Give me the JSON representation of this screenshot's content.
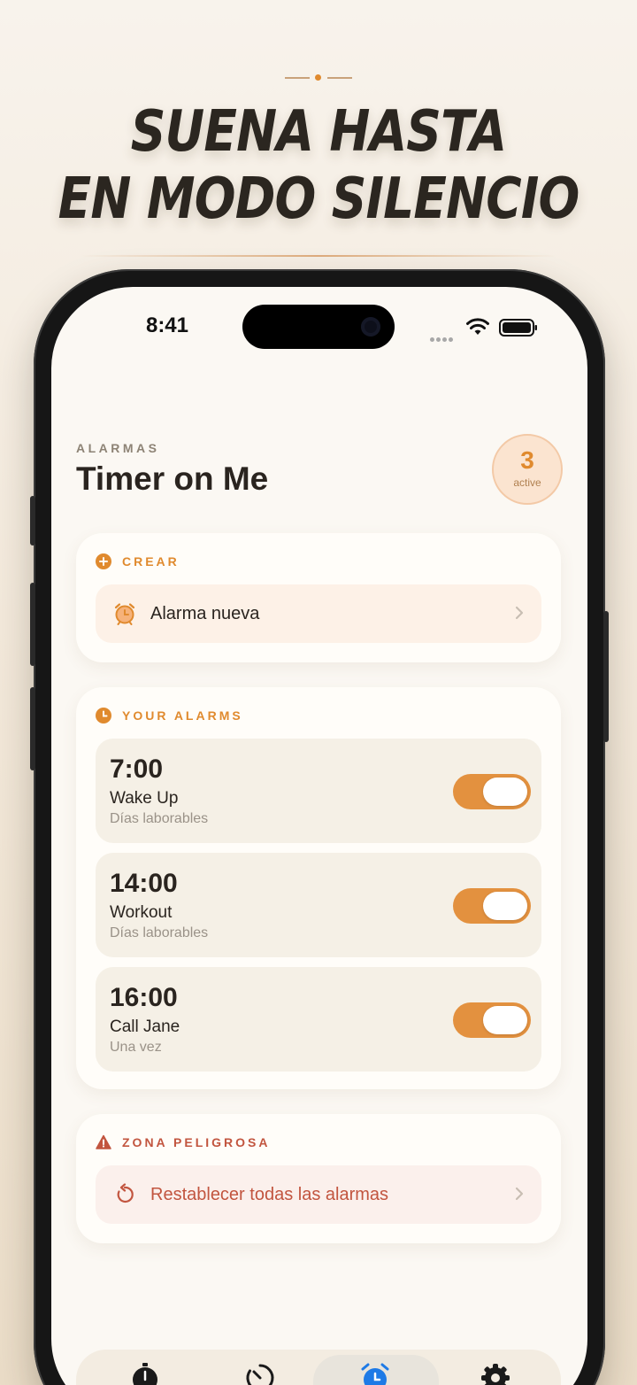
{
  "marketing": {
    "headline_line1": "SUENA HASTA",
    "headline_line2": "EN MODO SILENCIO"
  },
  "status_bar": {
    "time": "8:41"
  },
  "header": {
    "eyebrow": "ALARMAS",
    "title": "Timer on Me",
    "active_count": "3",
    "active_label": "active"
  },
  "create_section": {
    "label": "CREAR",
    "new_alarm_label": "Alarma nueva"
  },
  "alarms_section": {
    "label": "YOUR ALARMS",
    "alarms": [
      {
        "time": "7:00",
        "name": "Wake Up",
        "repeat": "Días laborables",
        "enabled": true
      },
      {
        "time": "14:00",
        "name": "Workout",
        "repeat": "Días laborables",
        "enabled": true
      },
      {
        "time": "16:00",
        "name": "Call Jane",
        "repeat": "Una vez",
        "enabled": true
      }
    ]
  },
  "danger_section": {
    "label": "ZONA PELIGROSA",
    "reset_label": "Restablecer todas las alarmas"
  },
  "tab_bar": {
    "tabs": [
      {
        "icon": "stopwatch-icon",
        "selected": false
      },
      {
        "icon": "timer-icon",
        "selected": false
      },
      {
        "icon": "alarm-clock-icon",
        "selected": true
      },
      {
        "icon": "gear-icon",
        "selected": false
      }
    ]
  },
  "colors": {
    "accent": "#e08a2e",
    "danger": "#c2553f",
    "toggle_on": "#e3913f",
    "selected_tab": "#1e7ae6"
  }
}
